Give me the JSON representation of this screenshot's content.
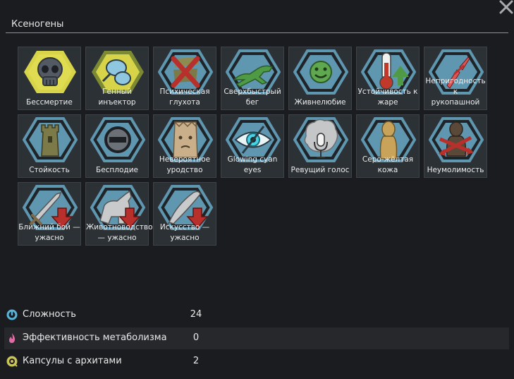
{
  "window": {
    "title": "Ксеногены"
  },
  "genes": [
    {
      "label": "Бессмертие",
      "icon": "skull-icon"
    },
    {
      "label": "Генный\nинъектор",
      "icon": "injector-icon"
    },
    {
      "label": "Психическая\nглухота",
      "icon": "psychic-deafness-icon"
    },
    {
      "label": "Сверхбыстрый\nбег",
      "icon": "running-creature-icon"
    },
    {
      "label": "Живнелюбие",
      "icon": "smiley-face-icon"
    },
    {
      "label": "Устойчивость к\nжаре",
      "icon": "thermometer-up-icon"
    },
    {
      "label": "Непригодность к\nрукопашной",
      "icon": "broken-sword-icon"
    },
    {
      "label": "Стойкость",
      "icon": "tower-icon"
    },
    {
      "label": "Бесплодие",
      "icon": "no-entry-icon"
    },
    {
      "label": "Невероятное\nуродство",
      "icon": "paper-bag-icon"
    },
    {
      "label": "Glowing cyan\neyes",
      "icon": "glowing-eye-icon"
    },
    {
      "label": "Ревущий голос",
      "icon": "microphone-icon"
    },
    {
      "label": "Серо-жёлтая\nкожа",
      "icon": "figure-icon"
    },
    {
      "label": "Неумолимость",
      "icon": "crossed-arrows-icon"
    },
    {
      "label": "Ближний бой —\nужасно",
      "icon": "melee-down-icon"
    },
    {
      "label": "Животноводство\n— ужасно",
      "icon": "animals-down-icon"
    },
    {
      "label": "Искусство —\nужасно",
      "icon": "artistic-down-icon"
    }
  ],
  "stats": [
    {
      "label": "Сложность",
      "value": "24",
      "icon": "complexity-icon",
      "color": "#58b4d9"
    },
    {
      "label": "Эффективность метаболизма",
      "value": "0",
      "icon": "metabolism-icon",
      "color": "#e06aa3"
    },
    {
      "label": "Капсулы с архитами",
      "value": "2",
      "icon": "archite-icon",
      "color": "#c9c35a"
    }
  ],
  "colors": {
    "hex_blue": "#5f97b0",
    "hex_yellow": "#d7d44a",
    "arrow_green": "#4f9a45",
    "arrow_red": "#b8302c"
  }
}
